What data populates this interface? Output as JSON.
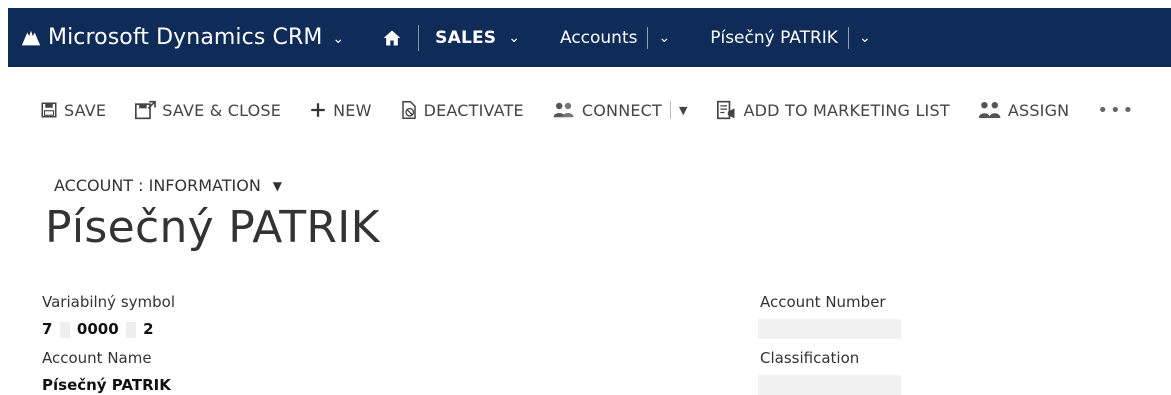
{
  "nav": {
    "app_title": "Microsoft Dynamics CRM",
    "area": "SALES",
    "entity": "Accounts",
    "record": "Písečný PATRIK"
  },
  "toolbar": {
    "save": "SAVE",
    "save_close": "SAVE & CLOSE",
    "new": "NEW",
    "deactivate": "DEACTIVATE",
    "connect": "CONNECT",
    "add_to_marketing_list": "ADD TO MARKETING LIST",
    "assign": "ASSIGN",
    "more": "•••"
  },
  "form": {
    "selector": "ACCOUNT : INFORMATION",
    "title": "Písečný PATRIK",
    "fields": {
      "variabilny_symbol": {
        "label": "Variabilný symbol",
        "value_a": "7",
        "value_b": "0000",
        "value_c": "2"
      },
      "account_name": {
        "label": "Account Name",
        "value": "Písečný PATRIK"
      },
      "account_number": {
        "label": "Account Number",
        "value": ""
      },
      "classification": {
        "label": "Classification",
        "value": ""
      }
    }
  },
  "colors": {
    "navbar": "#0f2b57",
    "toolbar_text": "#444444"
  },
  "icons": {
    "logo": "dynamics-logo-icon",
    "home": "home-icon",
    "save": "floppy-icon",
    "save_close": "floppy-close-icon",
    "new": "plus-icon",
    "deactivate": "deactivate-icon",
    "connect": "people-icon",
    "marketing": "marketing-list-icon",
    "assign": "assign-icon",
    "more": "more-icon"
  }
}
